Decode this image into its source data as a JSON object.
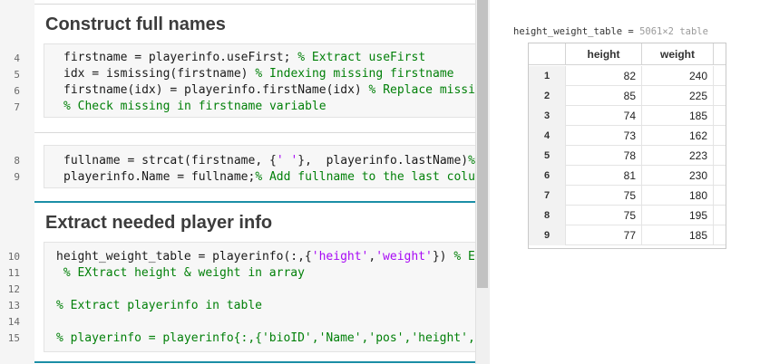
{
  "editor": {
    "sections": [
      {
        "heading": "Construct full names",
        "blocks": [
          {
            "lines": [
              {
                "num": "4",
                "segments": [
                  {
                    "t": "firstname = playerinfo.useFirst; ",
                    "c": "code"
                  },
                  {
                    "t": "% Extract useFirst",
                    "c": "cmt"
                  }
                ]
              },
              {
                "num": "5",
                "segments": [
                  {
                    "t": "idx = ismissing(firstname) ",
                    "c": "code"
                  },
                  {
                    "t": "% Indexing missing firstname",
                    "c": "cmt"
                  }
                ]
              },
              {
                "num": "6",
                "segments": [
                  {
                    "t": "firstname(idx) = playerinfo.firstName(idx) ",
                    "c": "code"
                  },
                  {
                    "t": "% Replace missin",
                    "c": "cmt"
                  }
                ]
              },
              {
                "num": "7",
                "segments": [
                  {
                    "t": "% Check missing in firstname variable",
                    "c": "cmt"
                  }
                ]
              }
            ]
          },
          {
            "lines": [
              {
                "num": "8",
                "segments": [
                  {
                    "t": "fullname = strcat(firstname, {",
                    "c": "code"
                  },
                  {
                    "t": "' '",
                    "c": "str"
                  },
                  {
                    "t": "},  playerinfo.lastName)",
                    "c": "code"
                  },
                  {
                    "t": "%",
                    "c": "cmt"
                  }
                ]
              },
              {
                "num": "9",
                "segments": [
                  {
                    "t": "playerinfo.Name = fullname;",
                    "c": "code"
                  },
                  {
                    "t": "% Add fullname to the last colum",
                    "c": "cmt"
                  }
                ]
              }
            ]
          }
        ]
      },
      {
        "heading": "Extract needed player info",
        "blocks": [
          {
            "lines": [
              {
                "num": "10",
                "segments": [
                  {
                    "t": "height_weight_table = playerinfo(:,{",
                    "c": "code"
                  },
                  {
                    "t": "'height'",
                    "c": "str"
                  },
                  {
                    "t": ",",
                    "c": "code"
                  },
                  {
                    "t": "'weight'",
                    "c": "str"
                  },
                  {
                    "t": "}) ",
                    "c": "code"
                  },
                  {
                    "t": "% Ex",
                    "c": "cmt"
                  }
                ]
              },
              {
                "num": "11",
                "segments": [
                  {
                    "t": " % EXtract height & weight in array",
                    "c": "cmt"
                  }
                ]
              },
              {
                "num": "12",
                "segments": []
              },
              {
                "num": "13",
                "segments": [
                  {
                    "t": "% Extract playerinfo in table",
                    "c": "cmt"
                  }
                ]
              },
              {
                "num": "14",
                "segments": []
              },
              {
                "num": "15",
                "segments": [
                  {
                    "t": "% playerinfo = playerinfo{:,{'bioID','Name','pos','height','",
                    "c": "cmt"
                  }
                ]
              }
            ]
          }
        ]
      }
    ]
  },
  "output": {
    "var_name": "height_weight_table",
    "var_eq": " = ",
    "var_meta": "5061×2 table",
    "columns": [
      "height",
      "weight"
    ],
    "rows": [
      {
        "idx": "1",
        "height": "82",
        "weight": "240"
      },
      {
        "idx": "2",
        "height": "85",
        "weight": "225"
      },
      {
        "idx": "3",
        "height": "74",
        "weight": "185"
      },
      {
        "idx": "4",
        "height": "73",
        "weight": "162"
      },
      {
        "idx": "5",
        "height": "78",
        "weight": "223"
      },
      {
        "idx": "6",
        "height": "81",
        "weight": "230"
      },
      {
        "idx": "7",
        "height": "75",
        "weight": "180"
      },
      {
        "idx": "8",
        "height": "75",
        "weight": "195"
      },
      {
        "idx": "9",
        "height": "77",
        "weight": "185"
      }
    ]
  }
}
